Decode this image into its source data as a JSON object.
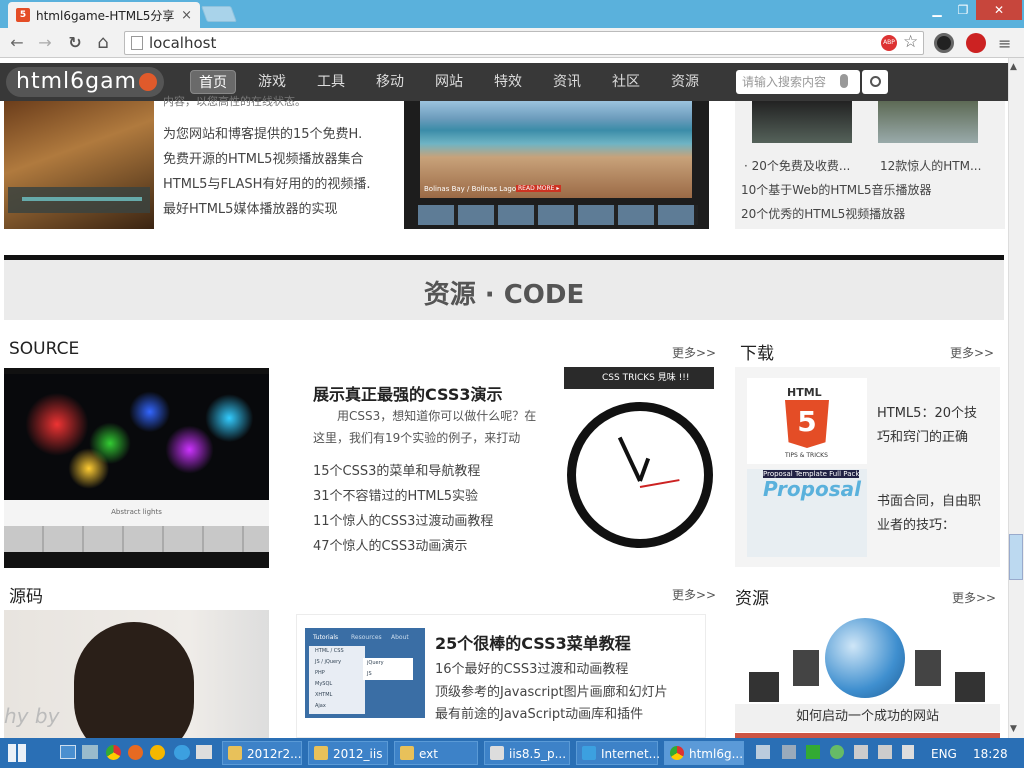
{
  "browser": {
    "tab_title": "html6game-HTML5分享",
    "address": "localhost",
    "win_min": "▁",
    "win_max": "❐",
    "win_close": "✕",
    "back": "←",
    "forward": "→",
    "reload": "↻",
    "home": "⌂",
    "abp": "ABP",
    "star": "☆"
  },
  "site": {
    "logo": "html6gam",
    "nav": [
      "首页",
      "游戏",
      "工具",
      "移动",
      "网站",
      "特效",
      "资讯",
      "社区",
      "资源"
    ],
    "search_placeholder": "请输入搜索内容"
  },
  "top_section": {
    "cut_text": "内容，以您高性的在线状态。",
    "lines": [
      "为您网站和博客提供的15个免费H.",
      "免费开源的HTML5视频播放器集合",
      "HTML5与FLASH有好用的的视频播.",
      "最好HTML5媒体播放器的实现"
    ],
    "video_caption": "Bolinas Bay / Bolinas Lagoon",
    "video_read_more": "READ MORE ▸",
    "thumb_captions": [
      "· 20个免费及收费...",
      "12款惊人的HTM..."
    ],
    "right_links": [
      "10个基于Web的HTML5音乐播放器",
      "20个优秀的HTML5视频播放器"
    ]
  },
  "banner": {
    "title": "资源 · CODE"
  },
  "source": {
    "heading": "SOURCE",
    "more": "更多>>",
    "article_title": "展示真正最强的CSS3演示",
    "article_desc": "用CSS3，想知道你可以做什么呢？在这里，我们有19个实验的例子，来打动",
    "links": [
      "15个CSS3的菜单和导航教程",
      "31个不容错过的HTML5实验",
      "11个惊人的CSS3过渡动画教程",
      "47个惊人的CSS3动画演示"
    ],
    "img_caption": "Abstract lights",
    "clock_bar": "CSS TRICKS 見味 !!!"
  },
  "download": {
    "heading": "下载",
    "more": "更多>>",
    "html5_badge": "HTML",
    "html5_num": "5",
    "html5_sub": "TIPS & TRICKS",
    "item1": "HTML5：20个技巧和窍门的正确",
    "proposal_title": "Proposal Template Full Pack",
    "proposal_word": "Proposal",
    "item2": "书面合同，自由职业者的技巧："
  },
  "yuanma": {
    "heading": "源码",
    "more": "更多>>",
    "article_title": "25个很棒的CSS3菜单教程",
    "links": [
      "16个最好的CSS3过渡和动画教程",
      "顶级参考的Javascript图片画廊和幻灯片",
      "最有前途的JavaScript动画库和插件"
    ],
    "menu_tabs": [
      "Tutorials",
      "Resources",
      "About"
    ],
    "menu_items": [
      "HTML / CSS",
      "JS / jQuery",
      "PHP",
      "MySQL",
      "XHTML",
      "Ajax"
    ],
    "menu_sub": [
      "jQuery",
      "JS"
    ],
    "photo_text": "hy by"
  },
  "ziyuan": {
    "heading": "资源",
    "more": "更多>>",
    "caption": "如何启动一个成功的网站"
  },
  "taskbar": {
    "items": [
      "2012r2...",
      "2012_iis",
      "ext",
      "iis8.5_p...",
      "Internet...",
      "html6g..."
    ],
    "lang": "ENG",
    "time": "18:28"
  },
  "colors": {
    "chrome_blue": "#5ab1dc",
    "nav_dark": "#383838",
    "taskbar": "#2a6fb5",
    "accent_red": "#e05a2b"
  }
}
